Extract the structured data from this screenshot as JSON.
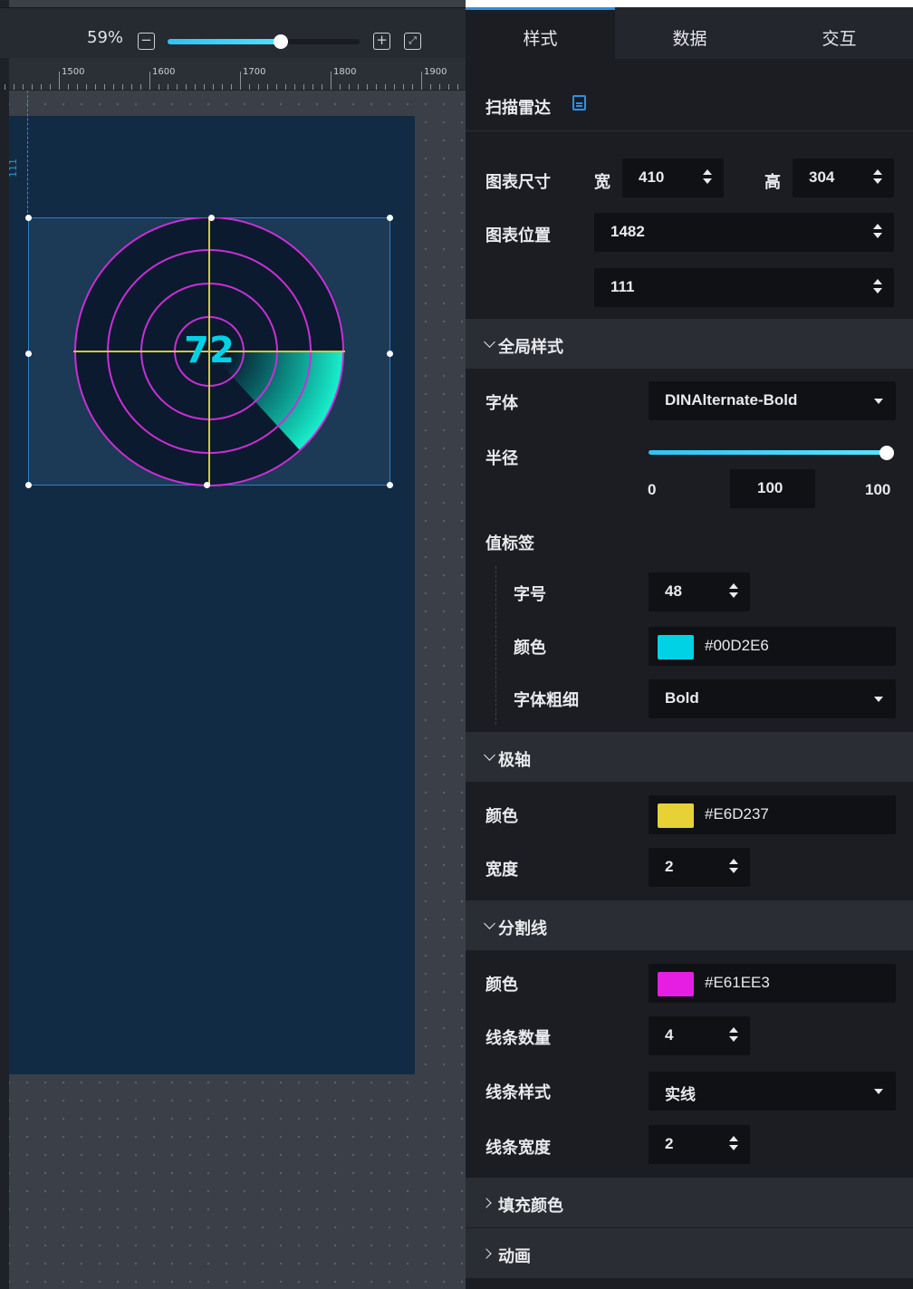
{
  "zoom": {
    "label": "59%",
    "value_percent": 59
  },
  "ruler": {
    "labels": [
      "1500",
      "1600",
      "1700",
      "1800",
      "1900"
    ]
  },
  "guide": {
    "label": "111"
  },
  "chart": {
    "value_label": "72",
    "rings": 4,
    "axis_color": "#E6D237",
    "ring_color": "#E61EE3",
    "value_color": "#00D2E6"
  },
  "tabs": [
    "样式",
    "数据",
    "交互"
  ],
  "component": {
    "title": "扫描雷达"
  },
  "size": {
    "label": "图表尺寸",
    "width_label": "宽",
    "width": "410",
    "height_label": "高",
    "height": "304"
  },
  "position": {
    "label": "图表位置",
    "x": "1482",
    "y": "111"
  },
  "global": {
    "section": "全局样式",
    "font_label": "字体",
    "font": "DINAlternate-Bold",
    "radius_label": "半径",
    "radius_min": "0",
    "radius_value": "100",
    "radius_max": "100"
  },
  "value_label": {
    "heading": "值标签",
    "size_label": "字号",
    "size": "48",
    "color_label": "颜色",
    "color": "#00D2E6",
    "weight_label": "字体粗细",
    "weight": "Bold"
  },
  "polar_axis": {
    "section": "极轴",
    "color_label": "颜色",
    "color": "#E6D237",
    "width_label": "宽度",
    "width": "2"
  },
  "split_line": {
    "section": "分割线",
    "color_label": "颜色",
    "color": "#E61EE3",
    "count_label": "线条数量",
    "count": "4",
    "style_label": "线条样式",
    "style": "实线",
    "width_label": "线条宽度",
    "width": "2"
  },
  "fill_color": {
    "section": "填充颜色"
  },
  "animation": {
    "section": "动画"
  },
  "colors": {
    "accent": "#2B8FE0",
    "panel_bg": "#1B1D22",
    "canvas_bg": "#122B45"
  }
}
